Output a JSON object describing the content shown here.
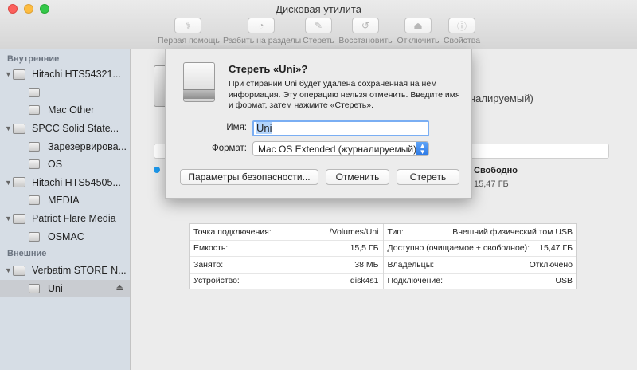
{
  "window": {
    "title": "Дисковая утилита"
  },
  "toolbar": {
    "items": [
      {
        "label": "Первая помощь",
        "icon": "stethoscope-icon",
        "glyph": "⚕"
      },
      {
        "label": "Разбить на разделы",
        "icon": "partition-icon",
        "glyph": "◔"
      },
      {
        "label": "Стереть",
        "icon": "erase-icon",
        "glyph": "✎"
      },
      {
        "label": "Восстановить",
        "icon": "restore-icon",
        "glyph": "↺"
      },
      {
        "label": "Отключить",
        "icon": "unmount-icon",
        "glyph": "⏏"
      },
      {
        "label": "Свойства",
        "icon": "info-icon",
        "glyph": "ⓘ"
      }
    ]
  },
  "sidebar": {
    "section_internal": "Внутренние",
    "section_external": "Внешние",
    "internal": [
      {
        "name": "Hitachi HTS54321...",
        "type": "disk"
      },
      {
        "name": "--",
        "type": "volume",
        "dim": true
      },
      {
        "name": "Mac Other",
        "type": "volume"
      },
      {
        "name": "SPCC Solid State...",
        "type": "disk"
      },
      {
        "name": "Зарезервирова...",
        "type": "volume"
      },
      {
        "name": "OS",
        "type": "volume"
      },
      {
        "name": "Hitachi HTS54505...",
        "type": "disk"
      },
      {
        "name": "MEDIA",
        "type": "volume"
      },
      {
        "name": "Patriot Flare Media",
        "type": "disk"
      },
      {
        "name": "OSMAC",
        "type": "volume"
      }
    ],
    "external": [
      {
        "name": "Verbatim STORE N...",
        "type": "disk"
      },
      {
        "name": "Uni",
        "type": "volume",
        "selected": true
      }
    ]
  },
  "main": {
    "subtitle_fragment": "налируемый)",
    "free_label": "Свободно",
    "free_value": "15,47 ГБ",
    "info_left": [
      {
        "k": "Точка подключения:",
        "v": "/Volumes/Uni"
      },
      {
        "k": "Емкость:",
        "v": "15,5 ГБ"
      },
      {
        "k": "Занято:",
        "v": "38 МБ"
      },
      {
        "k": "Устройство:",
        "v": "disk4s1"
      }
    ],
    "info_right": [
      {
        "k": "Тип:",
        "v": "Внешний физический том USB"
      },
      {
        "k": "Доступно (очищаемое + свободное):",
        "v": "15,47 ГБ"
      },
      {
        "k": "Владельцы:",
        "v": "Отключено"
      },
      {
        "k": "Подключение:",
        "v": "USB"
      }
    ]
  },
  "dialog": {
    "title": "Стереть «Uni»?",
    "message": "При стирании Uni будет удалена сохраненная на нем информация. Эту операцию нельзя отменить. Введите имя и формат, затем нажмите «Стереть».",
    "name_label": "Имя:",
    "name_value": "Uni",
    "format_label": "Формат:",
    "format_value": "Mac OS Extended (журналируемый)",
    "security_button": "Параметры безопасности...",
    "cancel_button": "Отменить",
    "erase_button": "Стереть"
  },
  "colors": {
    "accent": "#2b79e6",
    "sidebar": "#d6dde5",
    "used_dot": "#1d9bf0"
  }
}
